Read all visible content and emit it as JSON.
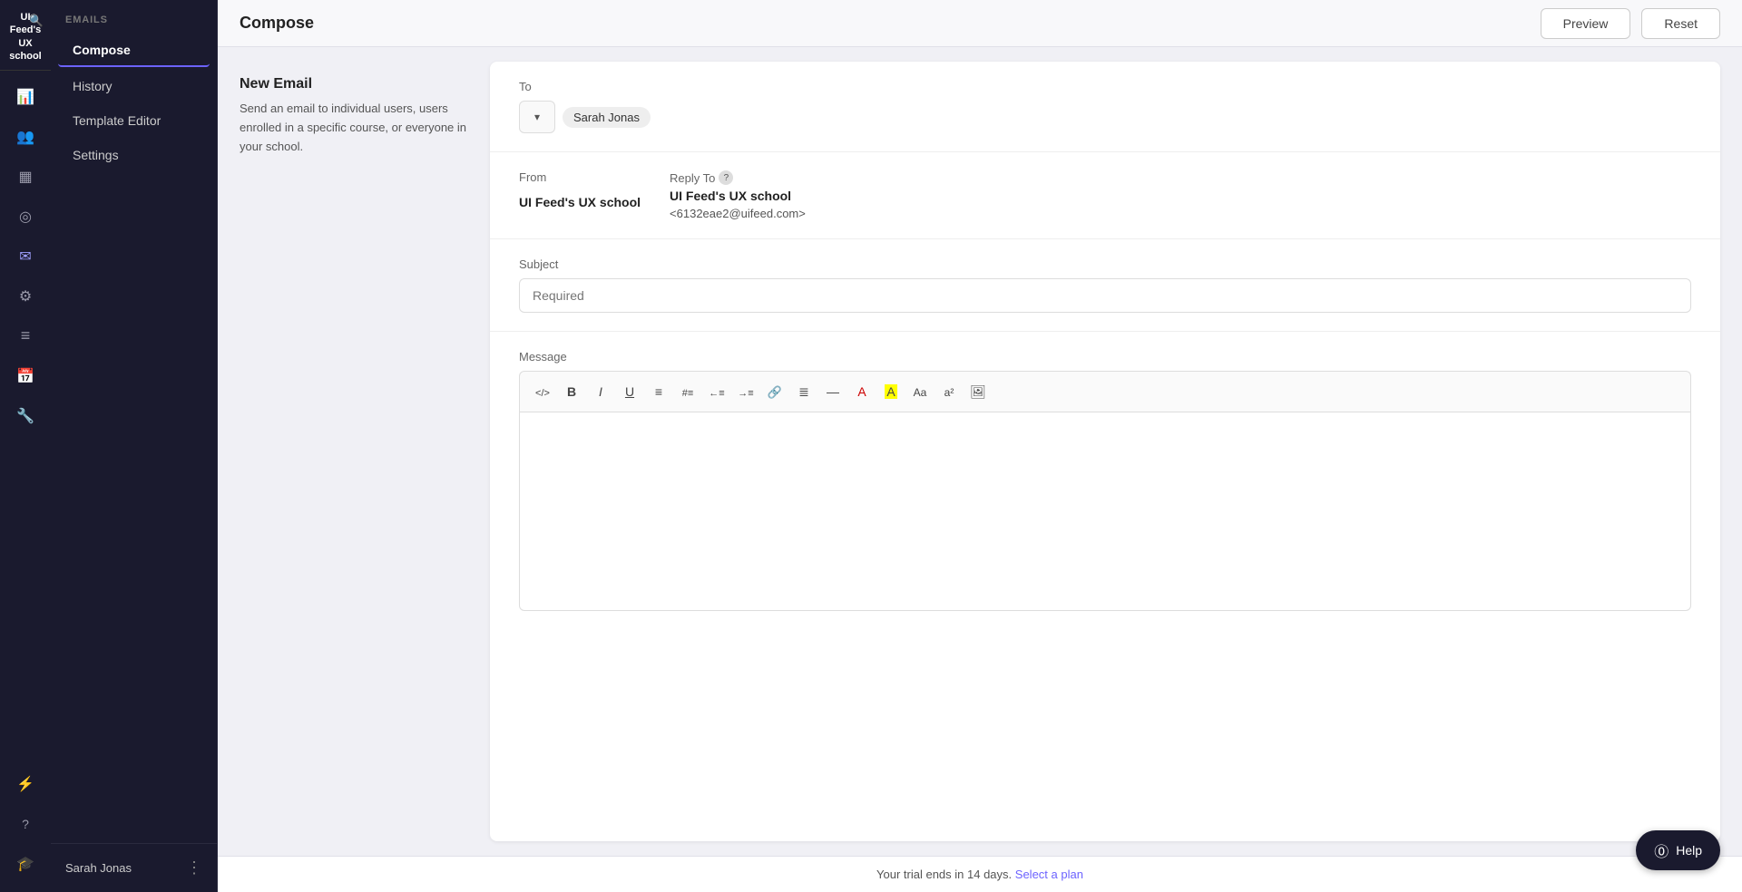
{
  "app": {
    "title": "UI Feed's UX school"
  },
  "topbar": {
    "title": "Compose",
    "preview_label": "Preview",
    "reset_label": "Reset"
  },
  "sidebar": {
    "section_label": "EMAILS",
    "nav_items": [
      {
        "id": "compose",
        "label": "Compose",
        "active": true
      },
      {
        "id": "history",
        "label": "History",
        "active": false
      },
      {
        "id": "template-editor",
        "label": "Template Editor",
        "active": false
      },
      {
        "id": "settings",
        "label": "Settings",
        "active": false
      }
    ],
    "bottom_user": "Sarah Jonas"
  },
  "left_panel": {
    "heading": "New Email",
    "description": "Send an email to individual users, users enrolled in a specific course, or everyone in your school."
  },
  "email_form": {
    "to_label": "To",
    "recipient": "Sarah Jonas",
    "from_label": "From",
    "from_value": "UI Feed's UX school",
    "reply_to_label": "Reply To",
    "reply_to_value": "UI Feed's UX school",
    "reply_to_email": "<6132eae2@uifeed.com>",
    "subject_label": "Subject",
    "subject_placeholder": "Required",
    "message_label": "Message"
  },
  "toolbar": {
    "buttons": [
      {
        "id": "code",
        "icon": "code-icon",
        "title": "Code"
      },
      {
        "id": "bold",
        "icon": "bold-icon",
        "title": "Bold"
      },
      {
        "id": "italic",
        "icon": "italic-icon",
        "title": "Italic"
      },
      {
        "id": "underline",
        "icon": "underline-icon",
        "title": "Underline"
      },
      {
        "id": "ul",
        "icon": "unordered-list-icon",
        "title": "Unordered List"
      },
      {
        "id": "ol",
        "icon": "ordered-list-icon",
        "title": "Ordered List"
      },
      {
        "id": "dedent",
        "icon": "dedent-icon",
        "title": "Dedent"
      },
      {
        "id": "indent",
        "icon": "indent-icon",
        "title": "Indent"
      },
      {
        "id": "link",
        "icon": "link-icon",
        "title": "Link"
      },
      {
        "id": "align",
        "icon": "align-icon",
        "title": "Align"
      },
      {
        "id": "hr",
        "icon": "horizontal-rule-icon",
        "title": "Horizontal Rule"
      },
      {
        "id": "font-color",
        "icon": "font-color-icon",
        "title": "Font Color"
      },
      {
        "id": "bg-color",
        "icon": "background-color-icon",
        "title": "Background Color"
      },
      {
        "id": "font-size",
        "icon": "font-size-icon",
        "title": "Font Size"
      },
      {
        "id": "superscript",
        "icon": "superscript-icon",
        "title": "Superscript"
      },
      {
        "id": "image",
        "icon": "image-icon",
        "title": "Insert Image"
      }
    ]
  },
  "bottom_bar": {
    "trial_text": "Your trial ends in 14 days.",
    "select_plan_label": "Select a plan"
  },
  "help_button": {
    "label": "Help"
  }
}
